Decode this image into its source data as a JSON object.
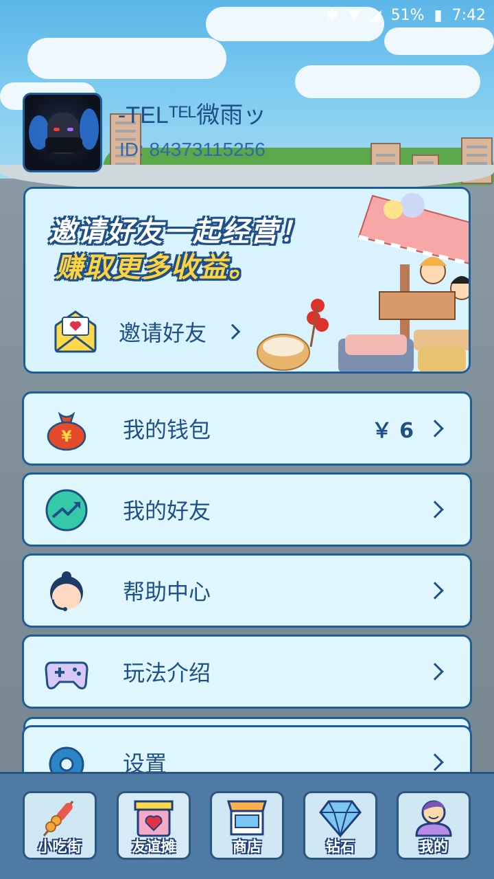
{
  "status_bar": {
    "battery": "51%",
    "time": "7:42"
  },
  "profile": {
    "name": "-TELᵀᴱᴸ微雨ッ",
    "id": "ID: 84373115256"
  },
  "banner": {
    "line1": "邀请好友一起经营！",
    "line2": "赚取更多收益。",
    "invite_label": "邀请好友"
  },
  "menu": {
    "wallet": {
      "label": "我的钱包",
      "value": "￥ 6",
      "icon": "money-bag-icon"
    },
    "friends": {
      "label": "我的好友",
      "icon": "trend-up-icon"
    },
    "help": {
      "label": "帮助中心",
      "icon": "support-agent-icon"
    },
    "guide": {
      "label": "玩法介绍",
      "icon": "gamepad-icon"
    },
    "settings": {
      "label": "设置",
      "icon": "gear-icon"
    }
  },
  "tabs": [
    {
      "label": "小吃街",
      "icon": "skewer-icon"
    },
    {
      "label": "友谊摊",
      "icon": "heart-stall-icon"
    },
    {
      "label": "商店",
      "icon": "shop-icon"
    },
    {
      "label": "钻石",
      "icon": "diamond-icon"
    },
    {
      "label": "我的",
      "icon": "profile-icon"
    }
  ],
  "colors": {
    "accent": "#1e4f87",
    "card_bg": "#dff6fd",
    "tabbar_bg": "#4f7aa4",
    "highlight_yellow": "#ffd23f"
  }
}
